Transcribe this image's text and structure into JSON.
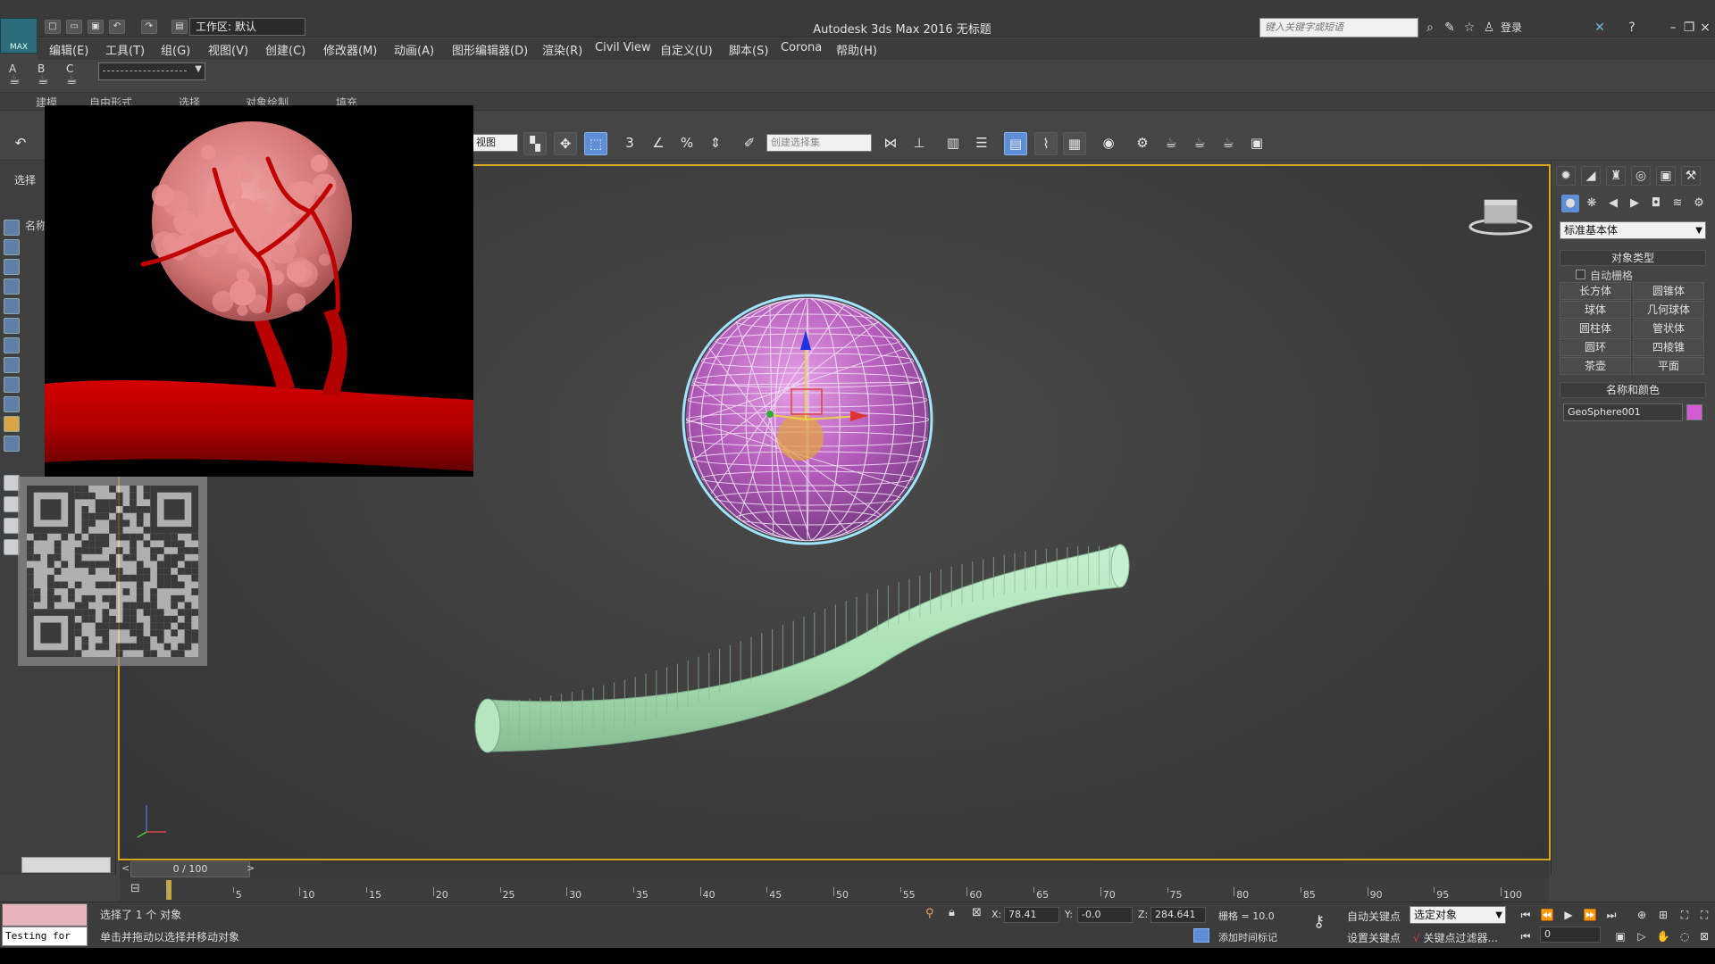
{
  "titlebar": {
    "logo": "MAX",
    "workspace": "工作区: 默认",
    "title": "Autodesk 3ds Max 2016    无标题",
    "search_placeholder": "键入关键字或短语",
    "login": "登录"
  },
  "menu": [
    "编辑(E)",
    "工具(T)",
    "组(G)",
    "视图(V)",
    "创建(C)",
    "修改器(M)",
    "动画(A)",
    "图形编辑器(D)",
    "渲染(R)",
    "Civil View",
    "自定义(U)",
    "脚本(S)",
    "Corona",
    "帮助(H)"
  ],
  "row2": {
    "a": "A",
    "b": "B",
    "c": "C"
  },
  "ribbon_tabs": [
    "建模",
    "自由形式",
    "选择",
    "对象绘制",
    "填充"
  ],
  "toolbar": {
    "view_combo": "视图",
    "selection_set": "创建选择集",
    "snap": "3",
    "percent": "%"
  },
  "left_panel": {
    "label": "选择",
    "name_col": "名称"
  },
  "command_panel": {
    "primitive_type": "标准基本体",
    "object_type_title": "对象类型",
    "autogrid": "自动栅格",
    "buttons": [
      "长方体",
      "圆锥体",
      "球体",
      "几何球体",
      "圆柱体",
      "管状体",
      "圆环",
      "四棱锥",
      "茶壶",
      "平面"
    ],
    "name_color_title": "名称和颜色",
    "object_name": "GeoSphere001",
    "object_color": "#d55ad6"
  },
  "timeline": {
    "slider": "0 / 100",
    "prev": "<",
    "next": ">",
    "ticks": [
      "5",
      "10",
      "15",
      "20",
      "25",
      "30",
      "35",
      "40",
      "45",
      "50",
      "55",
      "60",
      "65",
      "70",
      "75",
      "80",
      "85",
      "90",
      "95",
      "100"
    ]
  },
  "status": {
    "script_text": "Testing for AU",
    "selected": "选择了 1 个 对象",
    "prompt": "单击并拖动以选择并移动对象",
    "x_label": "X:",
    "x": "78.41",
    "y_label": "Y:",
    "y": "-0.0",
    "z_label": "Z:",
    "z": "284.641",
    "grid": "栅格 = 10.0",
    "auto_key": "自动关键点",
    "set_key": "设置关键点",
    "key_mode": "选定对象",
    "key_filter": "关键点过滤器...",
    "add_time_tag": "添加时间标记",
    "frame": "0"
  }
}
